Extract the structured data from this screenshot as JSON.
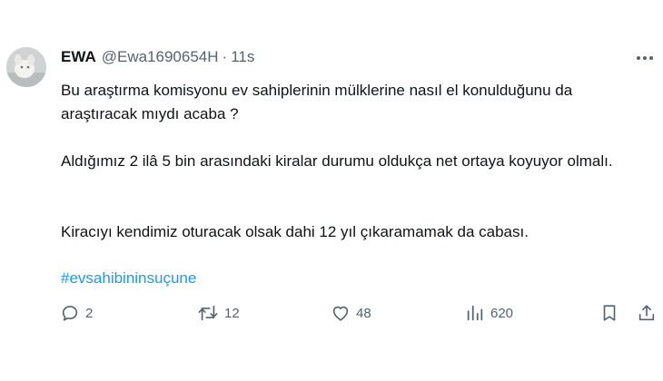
{
  "tweet": {
    "author": {
      "display_name": "EWA",
      "handle": "@Ewa1690654H",
      "separator": "·",
      "time": "11s"
    },
    "paragraphs": [
      "Bu araştırma komisyonu ev sahiplerinin mülklerine nasıl el konulduğunu da araştıracak mıydı acaba ?",
      "Aldığımız 2 ilâ 5 bin arasındaki kiralar durumu oldukça net ortaya koyuyor olmalı.",
      "Kiracıyı kendimiz oturacak olsak dahi 12 yıl çıkaramamak da cabası."
    ],
    "hashtag": "#evsahibininsuçune",
    "actions": {
      "replies": "2",
      "retweets": "12",
      "likes": "48",
      "views": "620"
    }
  },
  "icons": {
    "avatar": "avatar",
    "more": "more-icon",
    "reply": "reply-icon",
    "retweet": "retweet-icon",
    "like": "like-icon",
    "views": "views-icon",
    "bookmark": "bookmark-icon",
    "share": "share-icon"
  },
  "colors": {
    "text": "#0f1419",
    "secondary": "#536471",
    "link": "#1d9bf0",
    "background": "#ffffff"
  }
}
